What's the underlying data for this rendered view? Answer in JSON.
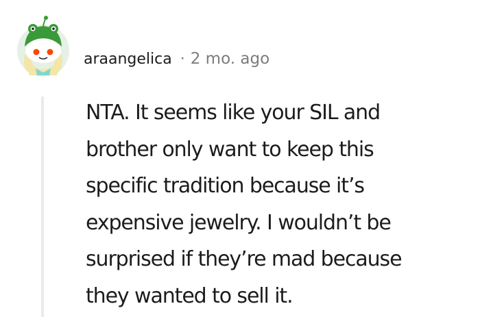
{
  "comment": {
    "author": "araangelica",
    "separator": "·",
    "timestamp": "2 mo. ago",
    "body": "NTA. It seems like your SIL and\nbrother only want to keep this\nspecific tradition because it’s\nexpensive jewelry. I wouldn’t be\nsurprised if they’re mad because\nthey wanted to sell it."
  },
  "avatar": {
    "icon": "snoo-avatar-icon",
    "colors": {
      "background": "#e6f0e6",
      "hat": "#3a9a3a",
      "hair": "#f2e6a8",
      "eyes": "#ff4500",
      "face": "#ffffff"
    }
  }
}
